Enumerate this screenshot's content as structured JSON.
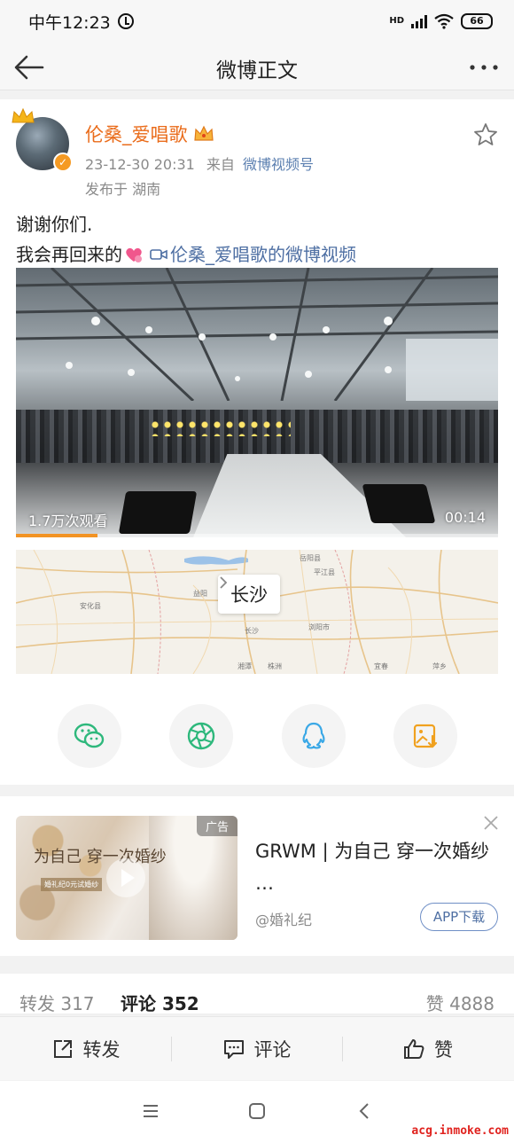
{
  "status_bar": {
    "time": "中午12:23",
    "network_label": "HD",
    "battery": "66"
  },
  "header": {
    "title": "微博正文",
    "back_icon": "arrow-left-icon",
    "more_icon": "more-dots-icon"
  },
  "post": {
    "author": "伦桑_爱唱歌",
    "timestamp": "23-12-30 20:31",
    "source_prefix": "来自",
    "source": "微博视频号",
    "location": "发布于 湖南",
    "text_line1": "谢谢你们.",
    "text_line2": "我会再回来的",
    "video_link": "伦桑_爱唱歌的微博视频",
    "video": {
      "views": "1.7万次观看",
      "duration": "00:14",
      "progress": 0.17
    },
    "map": {
      "city": "长沙",
      "labels": [
        "长沙",
        "益阳",
        "湘潭",
        "株洲",
        "浏阳市",
        "岳阳县",
        "宜春",
        "平江县",
        "安化县",
        "萍乡"
      ]
    }
  },
  "share_icons": [
    "wechat-icon",
    "moments-icon",
    "qq-icon",
    "save-image-icon"
  ],
  "ad": {
    "tag": "广告",
    "image_title": "为自己 穿一次婚纱",
    "image_subtitle": "婚礼纪0元试婚纱",
    "title": "GRWM | 为自己 穿一次婚纱 …",
    "source": "@婚礼纪",
    "cta": "APP下载"
  },
  "stats": {
    "repost": "转发 317",
    "comment": "评论 352",
    "like": "赞 4888"
  },
  "actions": {
    "repost": "转发",
    "comment": "评论",
    "like": "赞"
  },
  "watermark": "acg.inmoke.com",
  "colors": {
    "username": "#ea6c1b",
    "link": "#4e6fa3",
    "progress": "#f29324",
    "share_icon": "#2eb87c",
    "save_icon": "#f0a11f"
  }
}
